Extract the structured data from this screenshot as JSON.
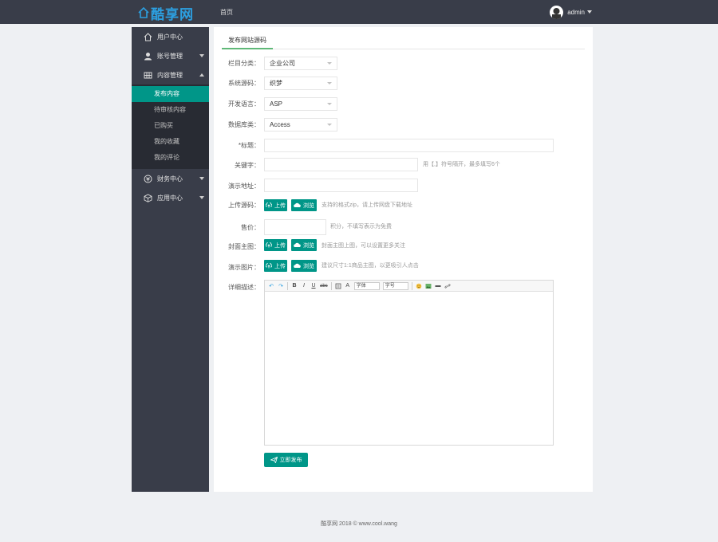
{
  "header": {
    "logo_text": "酷享网",
    "nav_home": "首页",
    "user_name": "admin"
  },
  "sidebar": {
    "items": [
      {
        "label": "用户中心",
        "icon": "home-icon"
      },
      {
        "label": "账号管理",
        "icon": "user-icon",
        "arrow": "down"
      },
      {
        "label": "内容管理",
        "icon": "grid-icon",
        "arrow": "up"
      }
    ],
    "sub_items": [
      {
        "label": "发布内容",
        "active": true
      },
      {
        "label": "待审核内容",
        "active": false
      },
      {
        "label": "已购买",
        "active": false
      },
      {
        "label": "我的收藏",
        "active": false
      },
      {
        "label": "我的评论",
        "active": false
      }
    ],
    "bottom_items": [
      {
        "label": "财务中心",
        "icon": "finance-icon",
        "arrow": "down"
      },
      {
        "label": "应用中心",
        "icon": "cube-icon",
        "arrow": "down"
      }
    ]
  },
  "tab": {
    "label": "发布网站源码"
  },
  "form": {
    "category": {
      "label": "栏目分类：",
      "value": "企业公司"
    },
    "system": {
      "label": "系统源码：",
      "value": "织梦"
    },
    "language": {
      "label": "开发语言：",
      "value": "ASP"
    },
    "database": {
      "label": "数据库类：",
      "value": "Access"
    },
    "title": {
      "label": "*标题：",
      "value": ""
    },
    "keywords": {
      "label": "关键字：",
      "value": "",
      "hint": "用【,】符号隔开，最多填写6个"
    },
    "demo": {
      "label": "演示地址：",
      "value": ""
    },
    "upload": {
      "label": "上传源码：",
      "btn_upload": "上传",
      "btn_browse": "浏览",
      "hint": "支持的格式zip，请上传网盘下载地址"
    },
    "price": {
      "label": "售价：",
      "value": "",
      "hint": "积分，不填写表示为免费"
    },
    "cover": {
      "label": "封面主图：",
      "btn_upload": "上传",
      "btn_browse": "浏览",
      "hint": "封面主图上图，可以设置更多关注"
    },
    "demo_img": {
      "label": "演示图片：",
      "btn_upload": "上传",
      "btn_browse": "浏览",
      "hint": "建议尺寸1:1商品主图，以更吸引人点击"
    },
    "detail": {
      "label": "详细描述："
    }
  },
  "editor": {
    "tb_undo": "↶",
    "tb_redo": "↷",
    "tb_bold": "B",
    "tb_italic": "I",
    "tb_underline": "U",
    "tb_strike": "abc",
    "tb_font_color": "A",
    "tb_font_family": "字体",
    "tb_font_size": "字号"
  },
  "submit_label": "立即发布",
  "footer": {
    "text": "酷享网 2018 © www.cool.wang"
  },
  "colors": {
    "primary": "#009688",
    "sidebar": "#393d49",
    "sidebar_sub": "#282b33",
    "logo": "#2c9fe0"
  }
}
